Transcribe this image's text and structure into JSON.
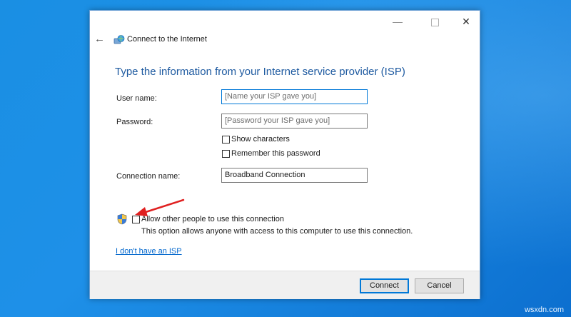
{
  "window": {
    "nav_title": "Connect to the Internet",
    "controls": {
      "minimize": "—",
      "close": "✕"
    }
  },
  "form": {
    "heading": "Type the information from your Internet service provider (ISP)",
    "username": {
      "label": "User name:",
      "placeholder": "[Name your ISP gave you]"
    },
    "password": {
      "label": "Password:",
      "placeholder": "[Password your ISP gave you]"
    },
    "show_characters": {
      "label": "Show characters",
      "checked": false
    },
    "remember_password": {
      "label": "Remember this password",
      "checked": false
    },
    "connection_name": {
      "label": "Connection name:",
      "value": "Broadband Connection"
    },
    "allow_others": {
      "label": "Allow other people to use this connection",
      "checked": false,
      "note": "This option allows anyone with access to this computer to use this connection."
    },
    "no_isp_link": "I don't have an ISP"
  },
  "buttons": {
    "connect": "Connect",
    "cancel": "Cancel"
  },
  "watermark": "wsxdn.com",
  "icons": [
    "back-arrow-icon",
    "globe-network-icon",
    "uac-shield-icon"
  ],
  "colors": {
    "accent": "#0078d7",
    "heading": "#1e5aa0",
    "annotation_arrow": "#e02020",
    "desktop": "#1a8fe3"
  }
}
